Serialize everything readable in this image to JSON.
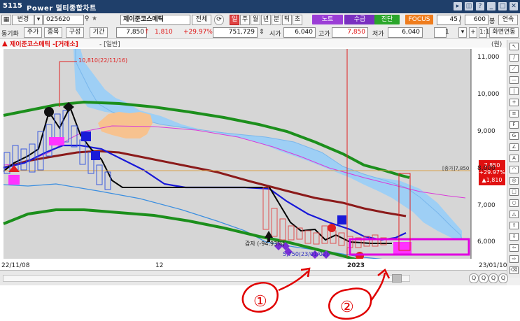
{
  "window": {
    "id": "5115",
    "title": "Power 멀티종합차트"
  },
  "toolbar1": {
    "change_label": "변경",
    "code": "025620",
    "stock_name": "제이준코스메틱",
    "all_label": "전체",
    "period_buttons": [
      "일",
      "주",
      "월",
      "년",
      "분",
      "틱",
      "초"
    ],
    "note_label": "노트",
    "supply_label": "수급",
    "diagnosis_label": "진단",
    "focus_label": "FOCUS",
    "count_value": "45",
    "total_value": "600",
    "bong_label": "봉",
    "continuous_label": "연속"
  },
  "toolbar2": {
    "sync_label": "동기화",
    "price_label": "주가",
    "item_label": "종목",
    "config_label": "구성",
    "period_label": "기간",
    "current_price": "7,850",
    "change": "1,810",
    "change_pct": "+29.97%",
    "volume": "751,729",
    "open_label": "시가",
    "open": "6,040",
    "high_label": "고가",
    "high": "7,850",
    "low_label": "저가",
    "low": "6,040",
    "spin_value": "1",
    "screen_label": "화면연동"
  },
  "chart_header": {
    "title": "제이준코스메틱 -[거래소]",
    "subtitle": "- [일반]",
    "unit_label": "(원)"
  },
  "chart_data": {
    "type": "candlestick",
    "title": "제이준코스메틱 -[거래소]",
    "x_tick_labels": [
      "22/11/08",
      "12",
      "2023",
      "23/01/10"
    ],
    "y_tick_labels": [
      "11,000",
      "10,000",
      "9,000",
      "8,000",
      "7,000",
      "6,000"
    ],
    "ylim": [
      5400,
      11300
    ],
    "annotations": {
      "high_label": "10,810(22/11/16)",
      "low_label": "5,750(23/01/02)",
      "reduction_label": "감자 (-94.93%)",
      "close_tag": "[종가]7,850",
      "price_box": [
        "7,850",
        "+29.97%",
        "▲1,810"
      ]
    },
    "series_colors": {
      "ma_green": "#1c8f1c",
      "ma_blue": "#1818d8",
      "ma_maroon": "#8b1a1a",
      "ma_lightblue": "#3a8ee0",
      "cloud": "#9ecff5",
      "kumo_orange": "#f7c28f",
      "envelope": "#e040e0",
      "highlight_box": "#e000e0"
    }
  },
  "handwritten_notes": [
    "①",
    "②"
  ],
  "bottom": {
    "zoom_labels": [
      "Q",
      "Q",
      "Q",
      "Q"
    ]
  }
}
